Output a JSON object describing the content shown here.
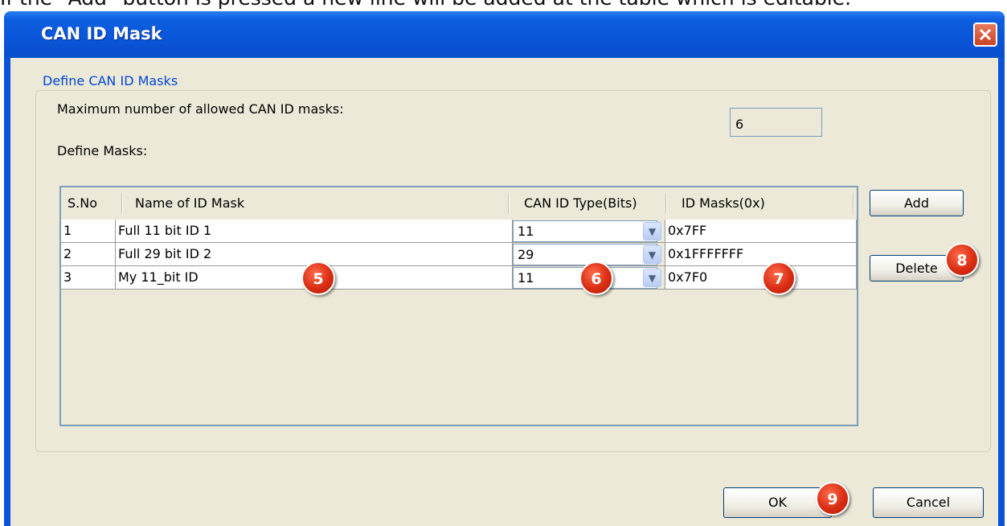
{
  "caption_text": "If the \"Add\" button is pressed a new line will be added at the table which is editable.",
  "window": {
    "title": "CAN ID Mask",
    "title_bar_color": "#0a53d8"
  },
  "group": {
    "legend": "Define CAN ID Masks",
    "max_label": "Maximum number of allowed CAN ID masks:",
    "max_value": "6",
    "define_label": "Define Masks:"
  },
  "table": {
    "headers": {
      "sno": "S.No",
      "name": "Name of ID Mask",
      "type": "CAN ID Type(Bits)",
      "mask": "ID Masks(0x)"
    },
    "rows": [
      {
        "sno": "1",
        "name": "Full 11 bit ID 1",
        "type": "11",
        "mask": "0x7FF"
      },
      {
        "sno": "2",
        "name": "Full 29 bit ID 2",
        "type": "29",
        "mask": "0x1FFFFFFF"
      },
      {
        "sno": "3",
        "name": "My 11_bit ID",
        "type": "11",
        "mask": "0x7F0"
      }
    ]
  },
  "buttons": {
    "add": "Add",
    "delete": "Delete",
    "ok": "OK",
    "cancel": "Cancel"
  },
  "badges": {
    "b5": "5",
    "b6": "6",
    "b7": "7",
    "b8": "8",
    "b9": "9"
  },
  "colors": {
    "accent": "#0046d5",
    "badge": "#d92d12",
    "dialog_bg": "#ece9d8"
  }
}
